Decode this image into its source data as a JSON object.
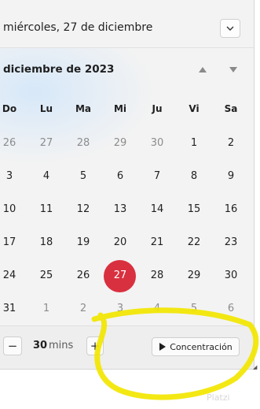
{
  "header": {
    "date_text": "miércoles, 27 de diciembre",
    "collapse_icon": "chevron-down-icon"
  },
  "calendar": {
    "month_title": "diciembre de 2023",
    "nav_up_icon": "triangle-up-icon",
    "nav_down_icon": "triangle-down-icon",
    "weekdays": [
      "Do",
      "Lu",
      "Ma",
      "Mi",
      "Ju",
      "Vi",
      "Sa"
    ],
    "weeks": [
      [
        "26",
        "27",
        "28",
        "29",
        "30",
        "1",
        "2"
      ],
      [
        "3",
        "4",
        "5",
        "6",
        "7",
        "8",
        "9"
      ],
      [
        "10",
        "11",
        "12",
        "13",
        "14",
        "15",
        "16"
      ],
      [
        "17",
        "18",
        "19",
        "20",
        "21",
        "22",
        "23"
      ],
      [
        "24",
        "25",
        "26",
        "27",
        "28",
        "29",
        "30"
      ],
      [
        "31",
        "1",
        "2",
        "3",
        "4",
        "5",
        "6"
      ]
    ],
    "today_color": "#d9303f"
  },
  "focus": {
    "minus_label": "−",
    "minutes": "30",
    "unit": "mins",
    "plus_label": "+",
    "button_label": "Concentración",
    "play_icon": "play-icon"
  },
  "watermark": "Platzi",
  "annotation_color": "#f2e600"
}
